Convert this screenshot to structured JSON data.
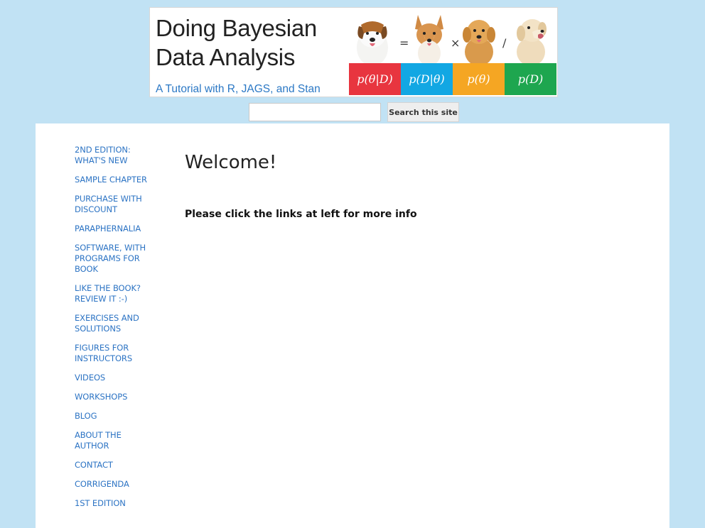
{
  "banner": {
    "title_line1": "Doing Bayesian",
    "title_line2": "Data Analysis",
    "subtitle": "A Tutorial with R, JAGS, and Stan",
    "operators": [
      "=",
      "×",
      "/"
    ],
    "formulas": [
      {
        "text": "p(θ|D)",
        "color": "#e8353f"
      },
      {
        "text": "p(D|θ)",
        "color": "#12a7e3"
      },
      {
        "text": "p(θ)",
        "color": "#f5a623"
      },
      {
        "text": "p(D)",
        "color": "#1ea64f"
      }
    ]
  },
  "search": {
    "placeholder": "",
    "button_label": "Search this site"
  },
  "sidebar": {
    "items": [
      {
        "label": "2nd Edition: What's New"
      },
      {
        "label": "Sample Chapter"
      },
      {
        "label": "Purchase with Discount"
      },
      {
        "label": "Paraphernalia"
      },
      {
        "label": "Software, with programs for book"
      },
      {
        "label": "Like the book? Review it :-)"
      },
      {
        "label": "Exercises and Solutions"
      },
      {
        "label": "Figures for instructors"
      },
      {
        "label": "Videos"
      },
      {
        "label": "Workshops"
      },
      {
        "label": "Blog"
      },
      {
        "label": "About the Author"
      },
      {
        "label": "Contact"
      },
      {
        "label": "Corrigenda"
      },
      {
        "label": "1st Edition"
      }
    ]
  },
  "main": {
    "heading": "Welcome!",
    "info": "Please click the links at left for more info"
  },
  "colors": {
    "background": "#c1e2f4",
    "link": "#2d74c4",
    "subtitle": "#2b78c5"
  }
}
